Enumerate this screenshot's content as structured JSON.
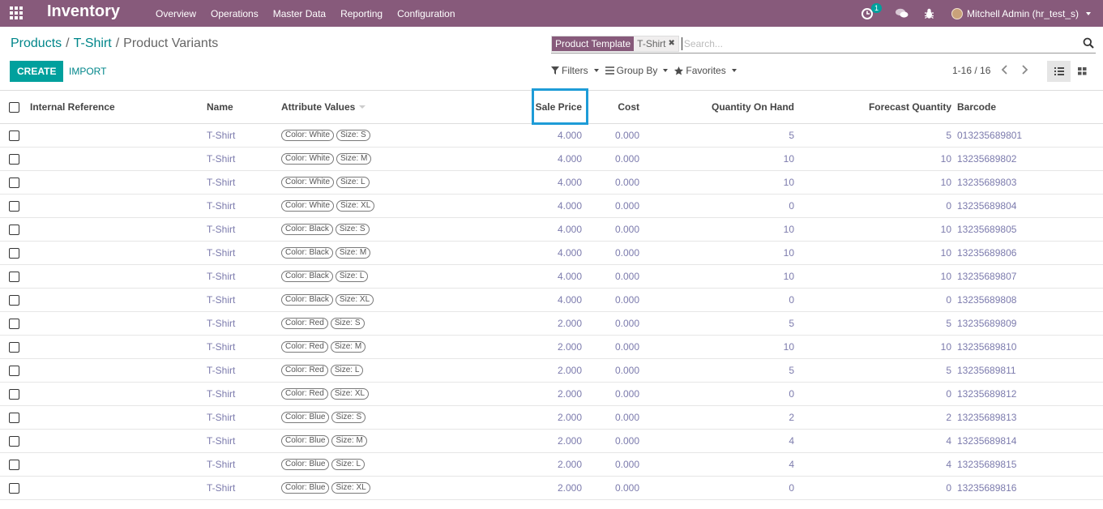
{
  "navbar": {
    "app_name": "Inventory",
    "menu": [
      "Overview",
      "Operations",
      "Master Data",
      "Reporting",
      "Configuration"
    ],
    "activity_count": "1",
    "user": "Mitchell Admin (hr_test_s)",
    "bg_color": "#875a7b"
  },
  "breadcrumb": {
    "items": [
      "Products",
      "T-Shirt"
    ],
    "current": "Product Variants"
  },
  "search": {
    "facet_label": "Product Template",
    "facet_value": "T-Shirt",
    "facet_remove": "✖",
    "placeholder": "Search..."
  },
  "actions": {
    "create": "CREATE",
    "import": "IMPORT"
  },
  "search_options": {
    "filters": "Filters",
    "group_by": "Group By",
    "favorites": "Favorites"
  },
  "pager": {
    "text": "1-16 / 16"
  },
  "table": {
    "headers": {
      "internal_reference": "Internal Reference",
      "name": "Name",
      "attribute_values": "Attribute Values",
      "sale_price": "Sale Price",
      "cost": "Cost",
      "qty_on_hand": "Quantity On Hand",
      "forecast_qty": "Forecast Quantity",
      "barcode": "Barcode"
    },
    "rows": [
      {
        "name": "T-Shirt",
        "color": "Color: White",
        "size": "Size: S",
        "sale_price": "4.000",
        "cost": "0.000",
        "qty": "5",
        "forecast": "5",
        "barcode": "013235689801"
      },
      {
        "name": "T-Shirt",
        "color": "Color: White",
        "size": "Size: M",
        "sale_price": "4.000",
        "cost": "0.000",
        "qty": "10",
        "forecast": "10",
        "barcode": "13235689802"
      },
      {
        "name": "T-Shirt",
        "color": "Color: White",
        "size": "Size: L",
        "sale_price": "4.000",
        "cost": "0.000",
        "qty": "10",
        "forecast": "10",
        "barcode": "13235689803"
      },
      {
        "name": "T-Shirt",
        "color": "Color: White",
        "size": "Size: XL",
        "sale_price": "4.000",
        "cost": "0.000",
        "qty": "0",
        "forecast": "0",
        "barcode": "13235689804"
      },
      {
        "name": "T-Shirt",
        "color": "Color: Black",
        "size": "Size: S",
        "sale_price": "4.000",
        "cost": "0.000",
        "qty": "10",
        "forecast": "10",
        "barcode": "13235689805"
      },
      {
        "name": "T-Shirt",
        "color": "Color: Black",
        "size": "Size: M",
        "sale_price": "4.000",
        "cost": "0.000",
        "qty": "10",
        "forecast": "10",
        "barcode": "13235689806"
      },
      {
        "name": "T-Shirt",
        "color": "Color: Black",
        "size": "Size: L",
        "sale_price": "4.000",
        "cost": "0.000",
        "qty": "10",
        "forecast": "10",
        "barcode": "13235689807"
      },
      {
        "name": "T-Shirt",
        "color": "Color: Black",
        "size": "Size: XL",
        "sale_price": "4.000",
        "cost": "0.000",
        "qty": "0",
        "forecast": "0",
        "barcode": "13235689808"
      },
      {
        "name": "T-Shirt",
        "color": "Color: Red",
        "size": "Size: S",
        "sale_price": "2.000",
        "cost": "0.000",
        "qty": "5",
        "forecast": "5",
        "barcode": "13235689809"
      },
      {
        "name": "T-Shirt",
        "color": "Color: Red",
        "size": "Size: M",
        "sale_price": "2.000",
        "cost": "0.000",
        "qty": "10",
        "forecast": "10",
        "barcode": "13235689810"
      },
      {
        "name": "T-Shirt",
        "color": "Color: Red",
        "size": "Size: L",
        "sale_price": "2.000",
        "cost": "0.000",
        "qty": "5",
        "forecast": "5",
        "barcode": "13235689811"
      },
      {
        "name": "T-Shirt",
        "color": "Color: Red",
        "size": "Size: XL",
        "sale_price": "2.000",
        "cost": "0.000",
        "qty": "0",
        "forecast": "0",
        "barcode": "13235689812"
      },
      {
        "name": "T-Shirt",
        "color": "Color: Blue",
        "size": "Size: S",
        "sale_price": "2.000",
        "cost": "0.000",
        "qty": "2",
        "forecast": "2",
        "barcode": "13235689813"
      },
      {
        "name": "T-Shirt",
        "color": "Color: Blue",
        "size": "Size: M",
        "sale_price": "2.000",
        "cost": "0.000",
        "qty": "4",
        "forecast": "4",
        "barcode": "13235689814"
      },
      {
        "name": "T-Shirt",
        "color": "Color: Blue",
        "size": "Size: L",
        "sale_price": "2.000",
        "cost": "0.000",
        "qty": "4",
        "forecast": "4",
        "barcode": "13235689815"
      },
      {
        "name": "T-Shirt",
        "color": "Color: Blue",
        "size": "Size: XL",
        "sale_price": "2.000",
        "cost": "0.000",
        "qty": "0",
        "forecast": "0",
        "barcode": "13235689816"
      }
    ]
  }
}
